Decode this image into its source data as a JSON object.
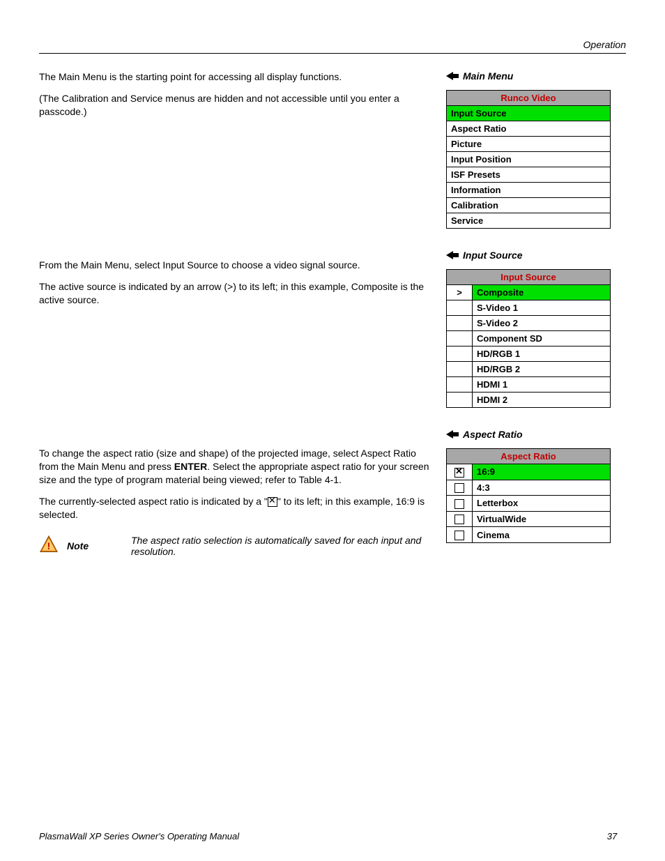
{
  "header": {
    "section": "Operation"
  },
  "sections": {
    "mainMenu": {
      "heading": "Main Menu",
      "paras": [
        "The Main Menu is the starting point for accessing all display functions.",
        "(The Calibration and Service menus are hidden and not accessible until you enter a passcode.)"
      ],
      "menu": {
        "title": "Runco Video",
        "items": [
          {
            "label": "Input Source",
            "highlight": true
          },
          {
            "label": "Aspect Ratio"
          },
          {
            "label": "Picture"
          },
          {
            "label": "Input Position"
          },
          {
            "label": "ISF Presets"
          },
          {
            "label": "Information"
          },
          {
            "label": "Calibration"
          },
          {
            "label": "Service"
          }
        ]
      }
    },
    "inputSource": {
      "heading": "Input Source",
      "paras": [
        "From the Main Menu, select Input Source to choose a video signal source.",
        "The active source is indicated by an arrow (>) to its left; in this example, Composite is the active source."
      ],
      "menu": {
        "title": "Input Source",
        "items": [
          {
            "indicator": ">",
            "label": "Composite",
            "highlight": true
          },
          {
            "indicator": "",
            "label": "S-Video 1"
          },
          {
            "indicator": "",
            "label": "S-Video 2"
          },
          {
            "indicator": "",
            "label": "Component SD"
          },
          {
            "indicator": "",
            "label": "HD/RGB 1"
          },
          {
            "indicator": "",
            "label": "HD/RGB 2"
          },
          {
            "indicator": "",
            "label": "HDMI 1"
          },
          {
            "indicator": "",
            "label": "HDMI 2"
          }
        ]
      }
    },
    "aspectRatio": {
      "heading": "Aspect Ratio",
      "para1_pre": "To change the aspect ratio (size and shape) of the projected image, select Aspect Ratio from the Main Menu and press ",
      "para1_bold": "ENTER",
      "para1_post": ". Select the appropriate aspect ratio for your screen size and the type of program material being viewed; refer to Table 4-1.",
      "para2_pre": "The currently-selected aspect ratio is indicated by a \"",
      "para2_post": "\" to its left; in this example, 16:9 is selected.",
      "note": {
        "label": "Note",
        "text": "The aspect ratio selection is automatically saved for each input and resolution."
      },
      "menu": {
        "title": "Aspect Ratio",
        "items": [
          {
            "checked": true,
            "label": "16:9",
            "highlight": true
          },
          {
            "checked": false,
            "label": "4:3"
          },
          {
            "checked": false,
            "label": "Letterbox"
          },
          {
            "checked": false,
            "label": "VirtualWide"
          },
          {
            "checked": false,
            "label": "Cinema"
          }
        ]
      }
    }
  },
  "footer": {
    "title": "PlasmaWall XP Series Owner's Operating Manual",
    "page": "37"
  }
}
